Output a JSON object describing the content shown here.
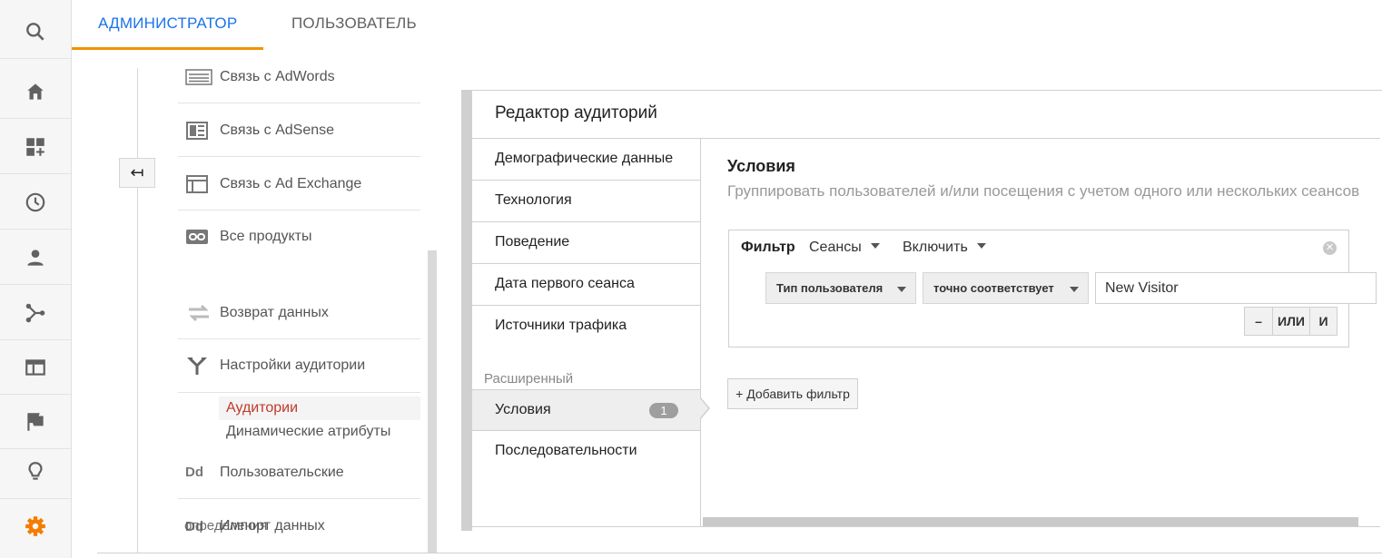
{
  "rail": {
    "icons": [
      "search-icon",
      "home-icon",
      "dashboard-add-icon",
      "clock-icon",
      "person-icon",
      "acquisition-icon",
      "behavior-icon",
      "flag-icon",
      "lightbulb-icon",
      "gear-icon"
    ],
    "accent": "#f57c00"
  },
  "tabs": {
    "admin": "АДМИНИСТРАТОР",
    "user": "ПОЛЬЗОВАТЕЛЬ",
    "active_color": "#1a73e8",
    "underline_color": "#f09300"
  },
  "admin_nav": {
    "items": [
      {
        "label": "Связь с AdWords",
        "icon": "adwords-icon"
      },
      {
        "label": "Связь с AdSense",
        "icon": "adsense-icon"
      },
      {
        "label": "Связь с Ad Exchange",
        "icon": "ad-exchange-icon"
      },
      {
        "label": "Все продукты",
        "icon": "link-icon"
      },
      {
        "label": "Возврат данных",
        "icon": "postback-icon"
      },
      {
        "label": "Настройки аудитории",
        "icon": "audience-fork-icon"
      },
      {
        "label": "Пользовательские",
        "icon": "dd-icon"
      },
      {
        "label": "Импорт данных",
        "icon": "dd-icon"
      }
    ],
    "subitems": [
      {
        "label": "Аудитории",
        "active": true
      },
      {
        "label": "Динамические атрибуты",
        "active": false
      }
    ],
    "overlay_text": "определения"
  },
  "editor": {
    "title": "Редактор аудиторий",
    "categories": [
      "Демографические данные",
      "Технология",
      "Поведение",
      "Дата первого сеанса",
      "Источники трафика"
    ],
    "advanced_label": "Расширенный",
    "advanced": [
      {
        "label": "Условия",
        "badge": "1",
        "active": true
      },
      {
        "label": "Последовательности",
        "active": false
      }
    ],
    "conditions": {
      "title": "Условия",
      "subtitle": "Группировать пользователей и/или посещения с учетом одного или нескольких сеансов",
      "filter": {
        "label": "Фильтр",
        "scope": "Сеансы",
        "mode": "Включить",
        "dimension": "Тип пользователя",
        "operator": "точно соответствует",
        "value": "New Visitor",
        "minus": "–",
        "or": "ИЛИ",
        "and": "И"
      },
      "add_filter": "+ Добавить фильтр"
    }
  }
}
